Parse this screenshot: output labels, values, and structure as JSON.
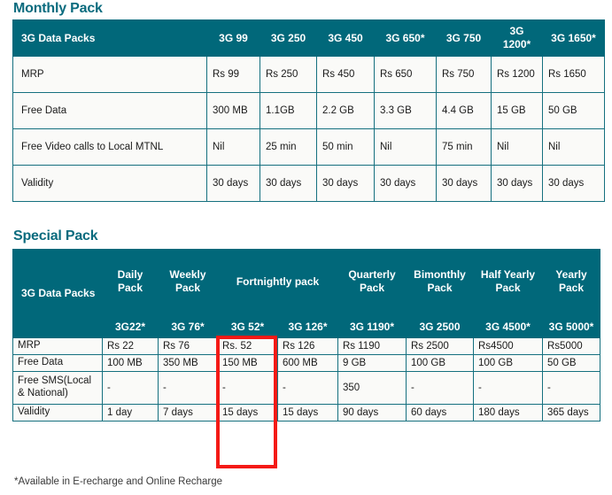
{
  "colors": {
    "teal_header": "#01687A",
    "title_text": "#0A6B7E",
    "cell_bg": "#FAFAF8",
    "border": "#15707F",
    "highlight_red": "#F41A16"
  },
  "monthly": {
    "title": "Monthly Pack",
    "row_header_label": "3G Data Packs",
    "columns": [
      "3G 99",
      "3G 250",
      "3G 450",
      "3G 650*",
      "3G 750",
      "3G 1200*",
      "3G 1650*"
    ],
    "rows": [
      {
        "label": "MRP",
        "values": [
          "Rs 99",
          "Rs 250",
          "Rs 450",
          "Rs 650",
          "Rs 750",
          "Rs 1200",
          "Rs 1650"
        ]
      },
      {
        "label": "Free Data",
        "values": [
          "300 MB",
          "1.1GB",
          "2.2 GB",
          "3.3 GB",
          "4.4 GB",
          "15 GB",
          "50 GB"
        ]
      },
      {
        "label": "Free Video calls to Local MTNL",
        "values": [
          "Nil",
          "25 min",
          "50 min",
          "Nil",
          "75 min",
          "Nil",
          "Nil"
        ]
      },
      {
        "label": "Validity",
        "values": [
          "30 days",
          "30 days",
          "30 days",
          "30 days",
          "30 days",
          "30 days",
          "30 days"
        ]
      }
    ]
  },
  "special": {
    "title": "Special Pack",
    "row_header_label": "3G Data Packs",
    "group_columns": [
      "Daily Pack",
      "Weekly Pack",
      "Fortnightly pack",
      "Quarterly Pack",
      "Bimonthly Pack",
      "Half Yearly Pack",
      "Yearly Pack"
    ],
    "code_columns": [
      "3G22*",
      "3G 76*",
      "3G 52*",
      "3G 126*",
      "3G 1190*",
      "3G 2500",
      "3G 4500*",
      "3G 5000*"
    ],
    "rows": [
      {
        "label": "MRP",
        "values": [
          "Rs 22",
          "Rs 76",
          "Rs. 52",
          "Rs 126",
          "Rs 1190",
          "Rs 2500",
          "Rs4500",
          "Rs5000"
        ]
      },
      {
        "label": "Free Data",
        "values": [
          "100 MB",
          "350 MB",
          "150 MB",
          "600 MB",
          "9 GB",
          "100 GB",
          "100 GB",
          "50 GB"
        ]
      },
      {
        "label": "Free SMS(Local & National)",
        "values": [
          "-",
          "-",
          "-",
          "-",
          "350",
          "-",
          "-",
          "-"
        ]
      },
      {
        "label": "Validity",
        "values": [
          "1 day",
          "7 days",
          "15 days",
          "15 days",
          "90 days",
          "60 days",
          "180 days",
          "365 days"
        ]
      }
    ],
    "highlighted_column_code": "3G 52*"
  },
  "footnote": "*Available in E-recharge and Online Recharge"
}
